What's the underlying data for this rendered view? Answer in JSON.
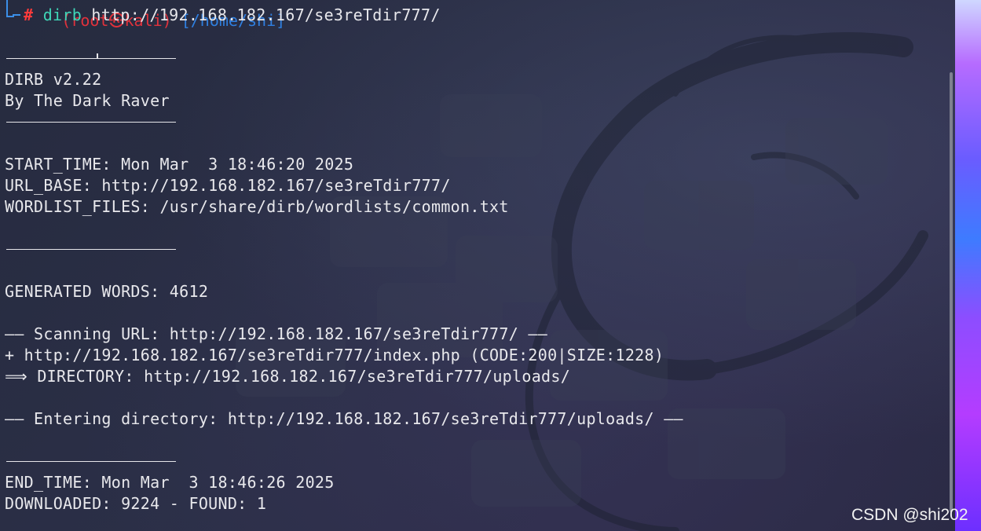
{
  "prompt": {
    "user_host": "(root㉿kali)",
    "directory": "[/home/shi]",
    "hash": "#",
    "command": "dirb",
    "argument": "http://192.168.182.167/se3reTdir777/"
  },
  "output": {
    "banner_name": "DIRB v2.22",
    "banner_author": "By The Dark Raver",
    "start_time": "START_TIME: Mon Mar  3 18:46:20 2025",
    "url_base": "URL_BASE: http://192.168.182.167/se3reTdir777/",
    "wordlist_files": "WORDLIST_FILES: /usr/share/dirb/wordlists/common.txt",
    "generated_words": "GENERATED WORDS: 4612",
    "scanning_url": "—— Scanning URL: http://192.168.182.167/se3reTdir777/ ——",
    "found_file": "+ http://192.168.182.167/se3reTdir777/index.php (CODE:200|SIZE:1228)",
    "directory_found": "⟹ DIRECTORY: http://192.168.182.167/se3reTdir777/uploads/",
    "entering_directory": "—— Entering directory: http://192.168.182.167/se3reTdir777/uploads/ ——",
    "end_time": "END_TIME: Mon Mar  3 18:46:26 2025",
    "downloaded": "DOWNLOADED: 9224 - FOUND: 1"
  },
  "watermark": "CSDN @shi202",
  "colors": {
    "prompt_root": "#e0323c",
    "prompt_dir": "#2f7fe0",
    "prompt_hash": "#ff3b3b",
    "command": "#3fd7b8",
    "text": "#e8e8ec",
    "background": "#23283a"
  }
}
